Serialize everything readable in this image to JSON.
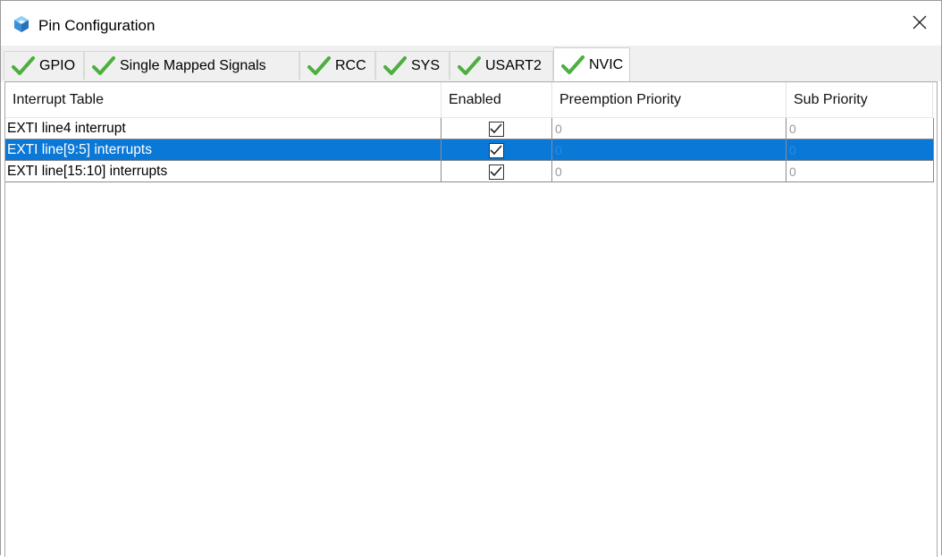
{
  "window": {
    "title": "Pin Configuration",
    "app_icon": "cube-app-icon",
    "close_icon": "close-icon"
  },
  "tabs": [
    {
      "label": "GPIO",
      "icon": "check-icon",
      "active": false
    },
    {
      "label": "Single Mapped Signals",
      "icon": "check-icon",
      "active": false
    },
    {
      "label": "RCC",
      "icon": "check-icon",
      "active": false
    },
    {
      "label": "SYS",
      "icon": "check-icon",
      "active": false
    },
    {
      "label": "USART2",
      "icon": "check-icon",
      "active": false
    },
    {
      "label": "NVIC",
      "icon": "check-icon",
      "active": true
    }
  ],
  "table": {
    "columns": [
      "Interrupt Table",
      "Enabled",
      "Preemption Priority",
      "Sub Priority"
    ],
    "rows": [
      {
        "name": "EXTI line4 interrupt",
        "enabled": true,
        "preemption": "0",
        "sub": "0",
        "selected": false
      },
      {
        "name": "EXTI line[9:5] interrupts",
        "enabled": true,
        "preemption": "0",
        "sub": "0",
        "selected": true
      },
      {
        "name": "EXTI line[15:10] interrupts",
        "enabled": true,
        "preemption": "0",
        "sub": "0",
        "selected": false
      }
    ]
  },
  "colors": {
    "selection": "#0a78d7",
    "check_green": "#4caf3e",
    "tab_background": "#f0f0f0"
  }
}
